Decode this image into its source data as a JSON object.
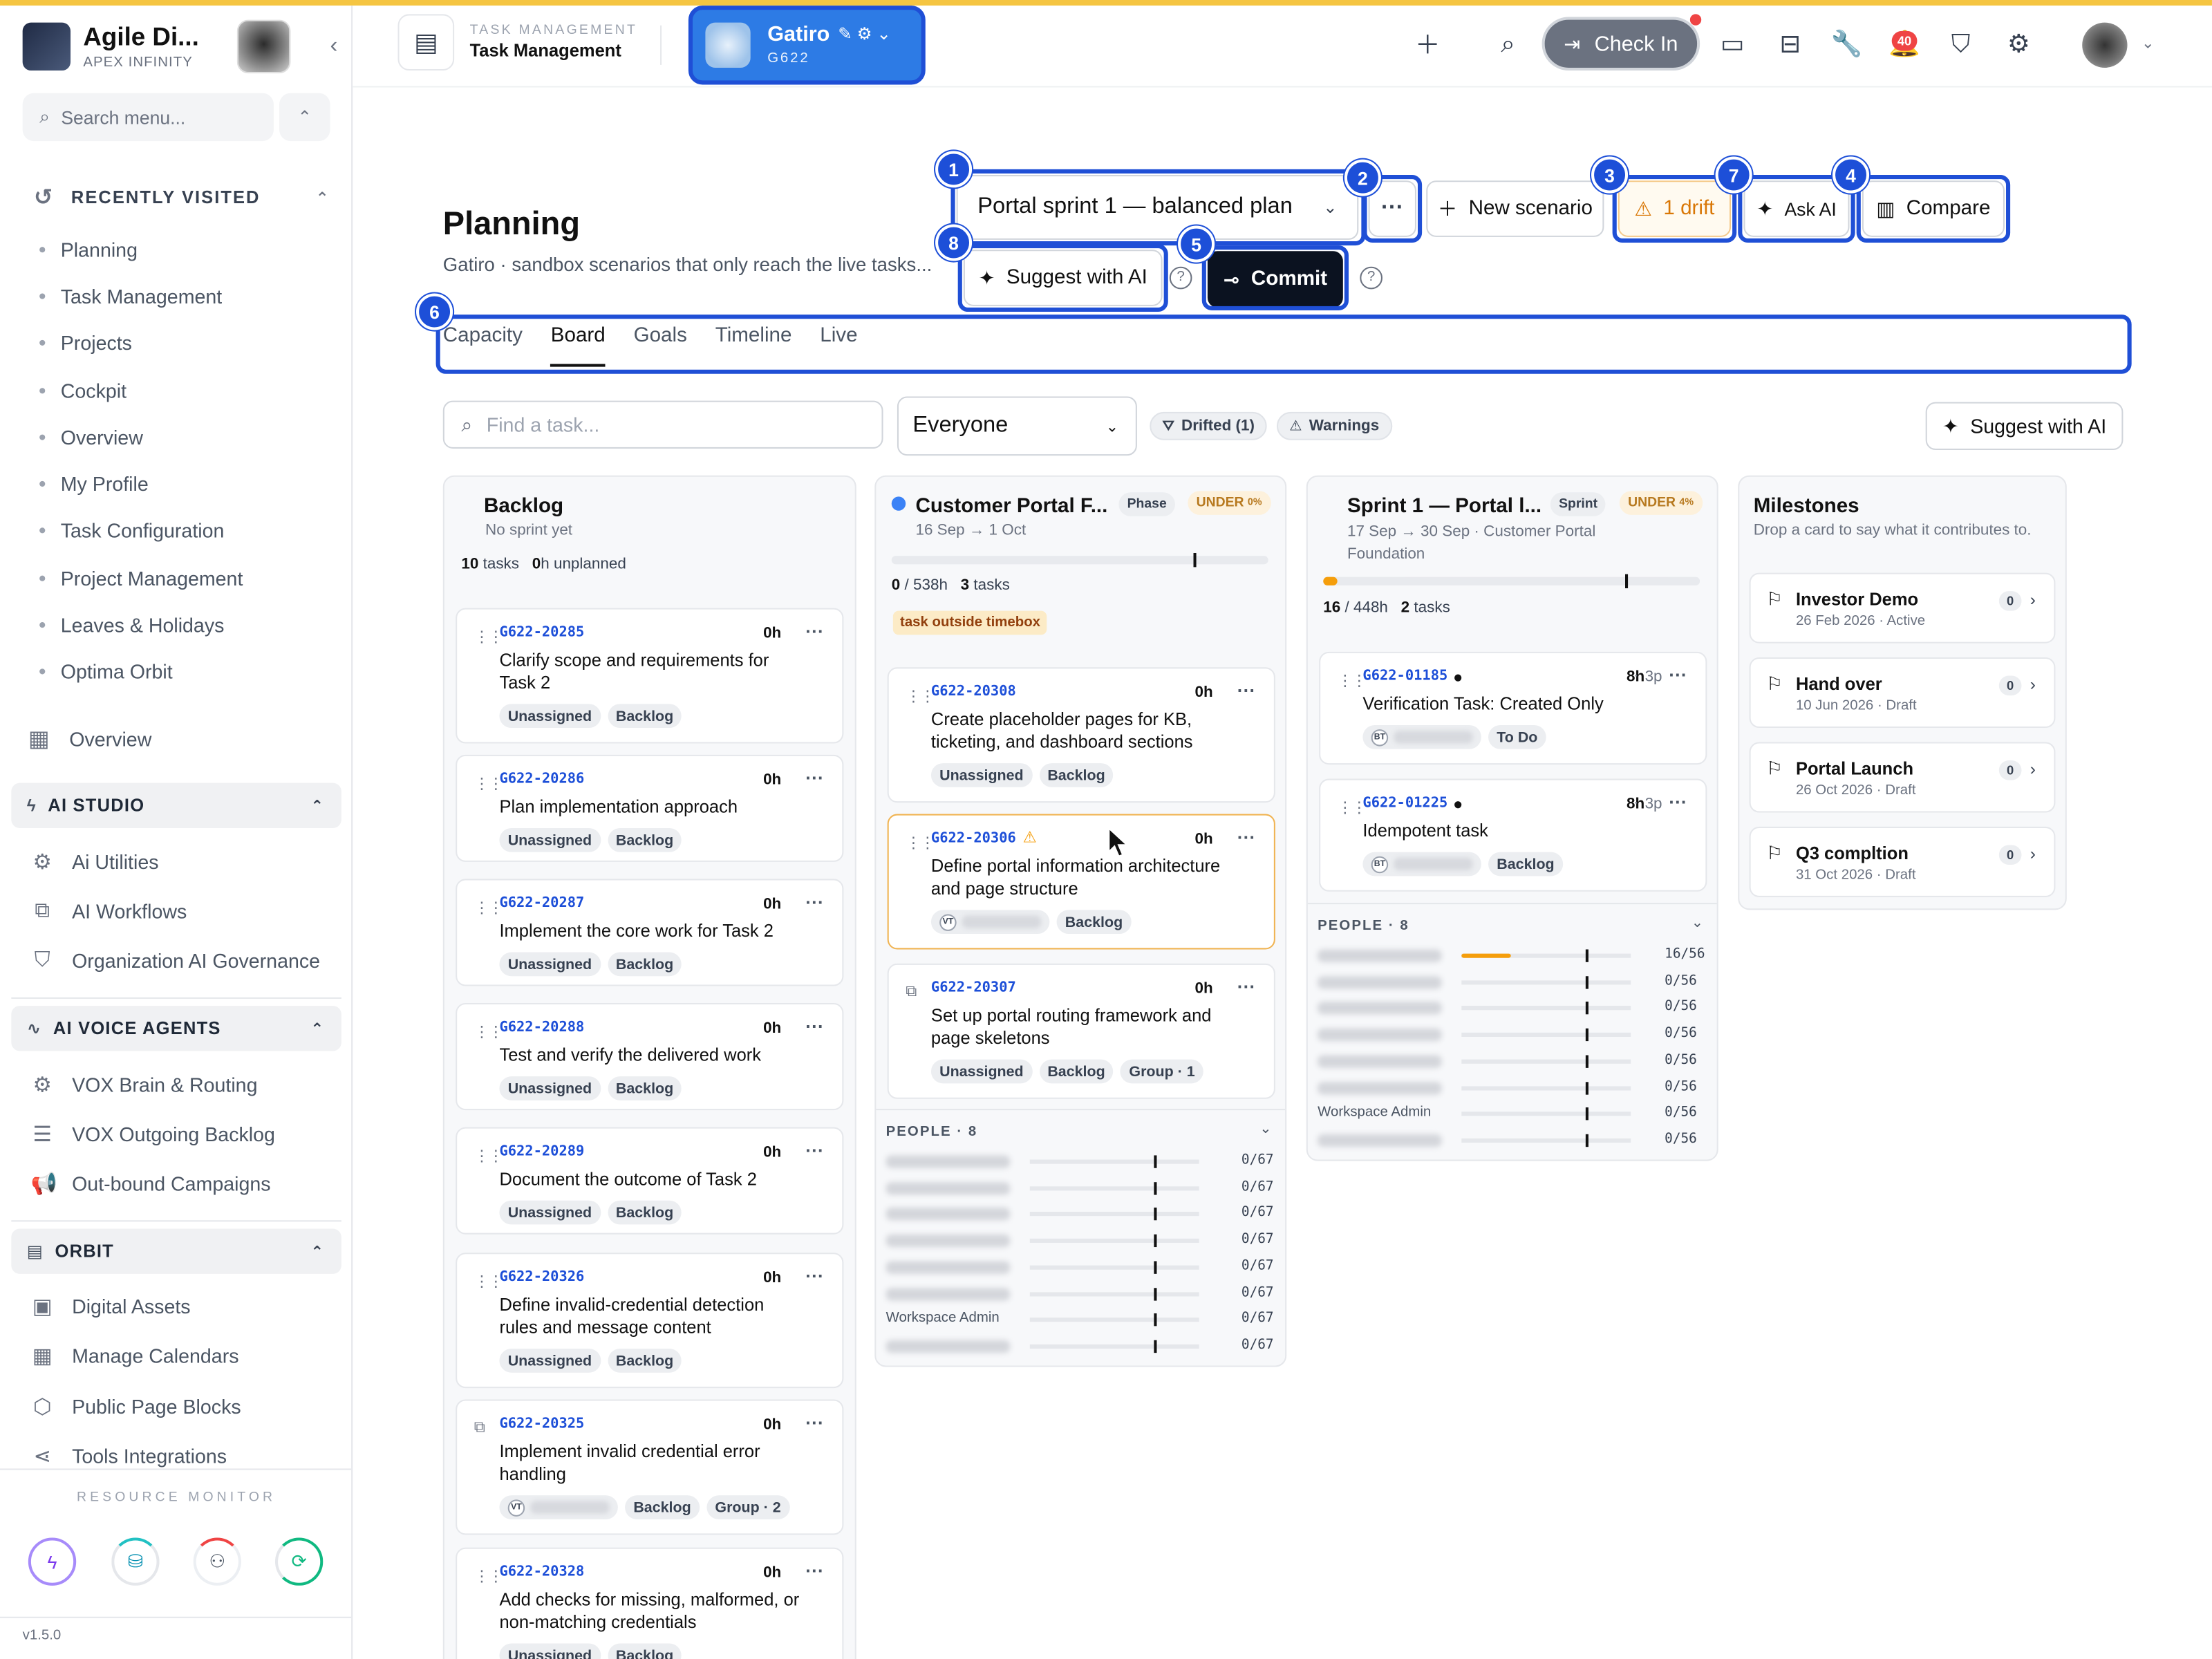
{
  "sidebar": {
    "brand_name": "Agile Di...",
    "brand_sub": "APEX INFINITY",
    "search_placeholder": "Search menu...",
    "recent_title": "RECENTLY VISITED",
    "recent_items": [
      "Planning",
      "Task Management",
      "Projects",
      "Cockpit",
      "Overview",
      "My Profile",
      "Task Configuration",
      "Project Management",
      "Leaves & Holidays",
      "Optima Orbit"
    ],
    "overview_label": "Overview",
    "ai_studio": {
      "title": "AI STUDIO",
      "items": [
        "Ai Utilities",
        "AI Workflows",
        "Organization AI Governance"
      ]
    },
    "ai_voice": {
      "title": "AI VOICE AGENTS",
      "items": [
        "VOX Brain & Routing",
        "VOX Outgoing Backlog",
        "Out-bound Campaigns"
      ]
    },
    "orbit": {
      "title": "ORBIT",
      "items": [
        "Digital Assets",
        "Manage Calendars",
        "Public Page Blocks",
        "Tools Integrations"
      ]
    },
    "resource_monitor": "RESOURCE MONITOR",
    "version": "v1.5.0"
  },
  "header": {
    "module_sub": "TASK MANAGEMENT",
    "module_title": "Task Management",
    "workspace_name": "Gatiro",
    "workspace_code": "G622",
    "checkin_label": "Check In",
    "notif_count": "40"
  },
  "page": {
    "title": "Planning",
    "subtitle": "Gatiro · sandbox scenarios that only reach the live tasks...",
    "scenario": "Portal sprint 1 — balanced plan",
    "more": "···",
    "new_scenario": "New scenario",
    "drift": "1 drift",
    "ask_ai": "Ask AI",
    "compare": "Compare",
    "suggest_ai": "Suggest with AI",
    "commit": "Commit",
    "tabs": [
      "Capacity",
      "Board",
      "Goals",
      "Timeline",
      "Live"
    ],
    "find_placeholder": "Find a task...",
    "assignee": "Everyone",
    "chip_drifted": "Drifted (1)",
    "chip_warnings": "Warnings",
    "suggest_ai_right": "Suggest with AI",
    "markers": [
      "1",
      "2",
      "3",
      "7",
      "4",
      "8",
      "5",
      "6"
    ]
  },
  "backlog": {
    "title": "Backlog",
    "sub": "No sprint yet",
    "tasks_count": "10",
    "tasks_label": "tasks",
    "unplanned_hours": "0",
    "unplanned_label": "h unplanned",
    "cards": [
      {
        "code": "G622-20285",
        "hours": "0h",
        "title": "Clarify scope and requirements for Task 2",
        "tags": [
          "Unassigned",
          "Backlog"
        ]
      },
      {
        "code": "G622-20286",
        "hours": "0h",
        "title": "Plan implementation approach",
        "tags": [
          "Unassigned",
          "Backlog"
        ]
      },
      {
        "code": "G622-20287",
        "hours": "0h",
        "title": "Implement the core work for Task 2",
        "tags": [
          "Unassigned",
          "Backlog"
        ]
      },
      {
        "code": "G622-20288",
        "hours": "0h",
        "title": "Test and verify the delivered work",
        "tags": [
          "Unassigned",
          "Backlog"
        ]
      },
      {
        "code": "G622-20289",
        "hours": "0h",
        "title": "Document the outcome of Task 2",
        "tags": [
          "Unassigned",
          "Backlog"
        ]
      },
      {
        "code": "G622-20326",
        "hours": "0h",
        "title": "Define invalid-credential detection rules and message content",
        "tags": [
          "Unassigned",
          "Backlog"
        ]
      },
      {
        "code": "G622-20325",
        "hours": "0h",
        "title": "Implement invalid credential error handling",
        "avatar": "VT",
        "tags": [
          "Backlog",
          "Group · 2"
        ]
      },
      {
        "code": "G622-20328",
        "hours": "0h",
        "title": "Add checks for missing, malformed, or non-matching credentials",
        "tags": [
          "Unassigned",
          "Backlog"
        ]
      }
    ]
  },
  "phase": {
    "title": "Customer Portal F...",
    "badge": "Phase",
    "under": "UNDER",
    "under_pct": "0%",
    "dates": "16 Sep → 1 Oct",
    "hours_used": "0",
    "hours_total": " / 538h",
    "tasks_count": "3",
    "tasks_label": "tasks",
    "warning": "task outside timebox",
    "progress": 0,
    "cards": [
      {
        "code": "G622-20308",
        "hours": "0h",
        "title": "Create placeholder pages for KB, ticketing, and dashboard sections",
        "tags": [
          "Unassigned",
          "Backlog"
        ]
      },
      {
        "code": "G622-20306",
        "hours": "0h",
        "title": "Define portal information architecture and page structure",
        "avatar": "VT",
        "tags": [
          "Backlog"
        ]
      },
      {
        "code": "G622-20307",
        "hours": "0h",
        "title": "Set up portal routing framework and page skeletons",
        "tags": [
          "Unassigned",
          "Backlog",
          "Group · 1"
        ]
      }
    ],
    "people_title": "PEOPLE · 8",
    "people": [
      {
        "name": "",
        "value": "0/67"
      },
      {
        "name": "",
        "value": "0/67"
      },
      {
        "name": "",
        "value": "0/67"
      },
      {
        "name": "",
        "value": "0/67"
      },
      {
        "name": "",
        "value": "0/67"
      },
      {
        "name": "",
        "value": "0/67"
      },
      {
        "name": "Workspace Admin",
        "value": "0/67"
      },
      {
        "name": "",
        "value": "0/67"
      }
    ]
  },
  "sprint": {
    "title": "Sprint 1 — Portal l...",
    "badge": "Sprint",
    "under": "UNDER",
    "under_pct": "4%",
    "dates": "17 Sep → 30 Sep · Customer Portal Foundation",
    "hours_used": "16",
    "hours_total": " / 448h",
    "tasks_count": "2",
    "tasks_label": "tasks",
    "progress": 0.036,
    "cards": [
      {
        "code": "G622-01185",
        "hours": "8h",
        "points": "3p",
        "title": "Verification Task: Created Only",
        "avatar": "BT",
        "tags": [
          "To Do"
        ]
      },
      {
        "code": "G622-01225",
        "hours": "8h",
        "points": "3p",
        "title": "Idempotent task",
        "avatar": "BT",
        "tags": [
          "Backlog"
        ]
      }
    ],
    "people_title": "PEOPLE · 8",
    "people": [
      {
        "name": "",
        "value": "16/56",
        "fill": 0.29
      },
      {
        "name": "",
        "value": "0/56"
      },
      {
        "name": "",
        "value": "0/56"
      },
      {
        "name": "",
        "value": "0/56"
      },
      {
        "name": "",
        "value": "0/56"
      },
      {
        "name": "",
        "value": "0/56"
      },
      {
        "name": "Workspace Admin",
        "value": "0/56"
      },
      {
        "name": "",
        "value": "0/56"
      }
    ]
  },
  "milestones": {
    "title": "Milestones",
    "sub": "Drop a card to say what it contributes to.",
    "items": [
      {
        "name": "Investor Demo",
        "date": "26 Feb 2026 · Active",
        "count": "0"
      },
      {
        "name": "Hand over",
        "date": "10 Jun 2026 · Draft",
        "count": "0"
      },
      {
        "name": "Portal Launch",
        "date": "26 Oct 2026 · Draft",
        "count": "0"
      },
      {
        "name": "Q3 compltion",
        "date": "31 Oct 2026 · Draft",
        "count": "0"
      }
    ]
  },
  "colors": {
    "accent": "#1d4fd8",
    "warning": "#f59e0b",
    "dark": "#0b1220",
    "topline": "#f5c542"
  }
}
